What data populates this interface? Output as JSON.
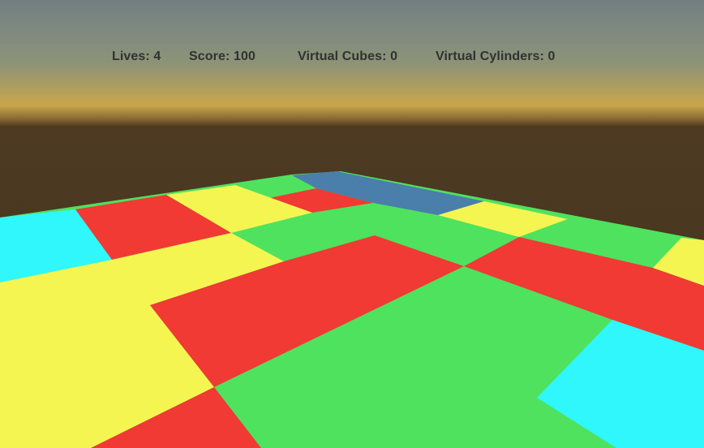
{
  "hud": {
    "lives": "Lives: 4",
    "score": "Score: 100",
    "virtual_cubes": "Virtual Cubes: 0",
    "virtual_cylinders": "Virtual Cylinders: 0"
  },
  "scene": {
    "sky_color_top": "#727f7f",
    "horizon_color": "#caa54a",
    "ground_color": "#4a3820",
    "tile_colors": {
      "red": "#f03a33",
      "green": "#4fe25e",
      "yellow": "#f5f552",
      "cyan": "#2ff7fb",
      "blue": "#4a7eab"
    }
  }
}
